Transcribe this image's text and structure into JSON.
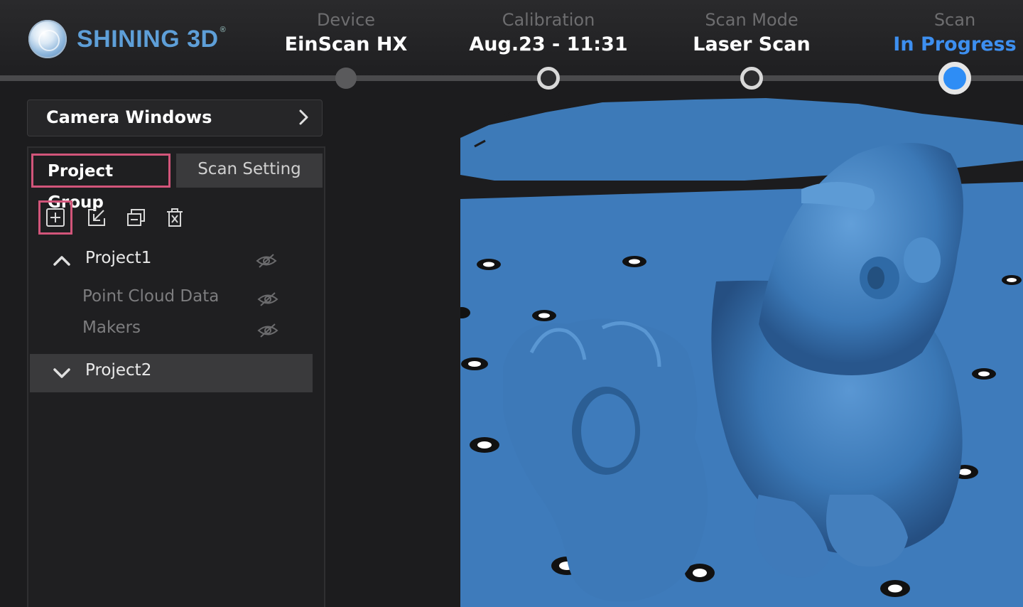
{
  "brand": {
    "name": "SHINING 3D",
    "mark": "®"
  },
  "steps": [
    {
      "caption": "Device",
      "value": "EinScan HX"
    },
    {
      "caption": "Calibration",
      "value": "Aug.23 - 11:31"
    },
    {
      "caption": "Scan Mode",
      "value": "Laser Scan"
    },
    {
      "caption": "Scan",
      "value": "In Progress"
    }
  ],
  "camera_windows": {
    "label": "Camera Windows",
    "icon": "chevron-right-icon"
  },
  "tabs": {
    "project_group": "Project Group",
    "scan_setting": "Scan Setting"
  },
  "toolbar": {
    "icons": [
      "add-project-icon",
      "import-icon",
      "duplicate-icon",
      "delete-icon"
    ]
  },
  "tree": {
    "project1": "Project1",
    "point_cloud": "Point Cloud Data",
    "makers": "Makers",
    "project2": "Project2"
  },
  "colors": {
    "accent": "#2e8df5",
    "highlight_box": "#d2557a",
    "scan_surface": "#3b78b8"
  }
}
